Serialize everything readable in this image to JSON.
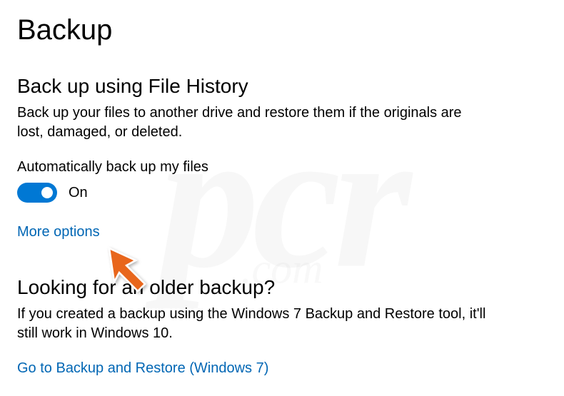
{
  "page": {
    "title": "Backup"
  },
  "section1": {
    "heading": "Back up using File History",
    "description": "Back up your files to another drive and restore them if the originals are lost, damaged, or deleted.",
    "toggle_label": "Automatically back up my files",
    "toggle_state": "On",
    "more_options_link": "More options"
  },
  "section2": {
    "heading": "Looking for an older backup?",
    "description": "If you created a backup using the Windows 7 Backup and Restore tool, it'll still work in Windows 10.",
    "link": "Go to Backup and Restore (Windows 7)"
  },
  "colors": {
    "accent": "#0078d4",
    "link": "#0066b4"
  }
}
